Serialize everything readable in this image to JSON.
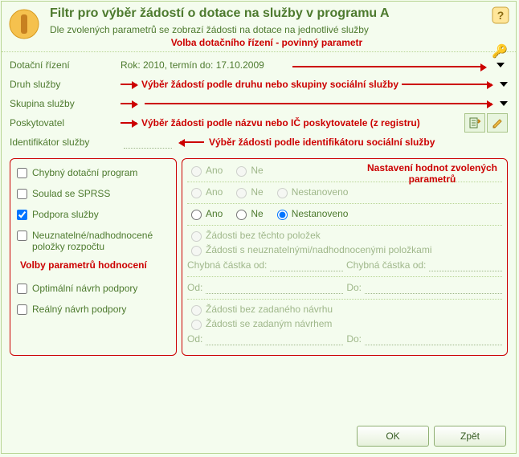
{
  "header": {
    "title": "Filtr pro výběr žádostí o dotace na služby v programu A",
    "subtitle": "Dle zvolených parametrů se zobrazí žádosti na dotace na jednotlivé služby"
  },
  "annotations": {
    "top": "Volba dotačního řízení - povinný parametr",
    "service_kind": "Výběr žádostí podle druhu nebo skupiny sociální služby",
    "provider": "Výběr žádosti podle názvu nebo IČ poskytovatele (z registru)",
    "identifier": "Výběr žádosti podle identifikátoru sociální služby",
    "left_panel": "Volby parametrů hodnocení",
    "right_panel": "Nastavení hodnot zvolených parametrů"
  },
  "fields": {
    "dotacni_rizeni": {
      "label": "Dotační řízení",
      "value": "Rok: 2010, termín do: 17.10.2009"
    },
    "druh_sluzby": {
      "label": "Druh služby",
      "value": ""
    },
    "skupina_sluzby": {
      "label": "Skupina služby",
      "value": ""
    },
    "poskytovatel": {
      "label": "Poskytovatel",
      "value": ""
    },
    "identifikator": {
      "label": "Identifikátor služby",
      "value": ""
    }
  },
  "checks": {
    "chybny_program": {
      "label": "Chybný dotační program",
      "checked": false
    },
    "soulad_sprss": {
      "label": "Soulad se SPRSS",
      "checked": false
    },
    "podpora_sluzby": {
      "label": "Podpora služby",
      "checked": true
    },
    "neuznatelne": {
      "label": "Neuznatelné/nadhodnocené položky rozpočtu",
      "checked": false
    },
    "optimalni_navrh": {
      "label": "Optimální návrh podpory",
      "checked": false
    },
    "realny_navrh": {
      "label": "Reálný návrh podpory",
      "checked": false
    }
  },
  "radios": {
    "ano": "Ano",
    "ne": "Ne",
    "nestanoveno": "Nestanoveno",
    "zadosti_bez_polozek": "Žádosti bez těchto položek",
    "zadosti_s_polozkami": "Žádosti s neuznatelnými/nadhodnocenými položkami",
    "zadosti_bez_navrhu": "Žádosti bez zadaného návrhu",
    "zadosti_s_navrhem": "Žádosti se zadaným návrhem"
  },
  "range": {
    "chybna_castka_od": "Chybná částka od:",
    "od": "Od:",
    "do": "Do:"
  },
  "buttons": {
    "ok": "OK",
    "back": "Zpět"
  }
}
